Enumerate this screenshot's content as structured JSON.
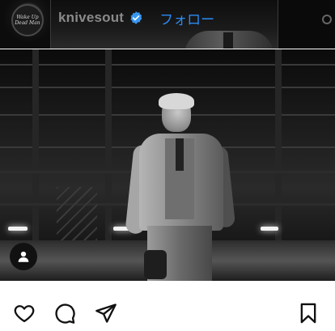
{
  "header": {
    "account": {
      "username": "knivesout",
      "verified": true,
      "follow_label": "フォロー",
      "avatar_text": "Wake Up Dead Man"
    }
  },
  "post": {
    "image_icon": "user-tag-icon"
  },
  "actions": {
    "like": "heart-icon",
    "comment": "comment-bubble-icon",
    "share": "paper-plane-icon",
    "save": "bookmark-icon"
  },
  "colors": {
    "follow": "#2a8cf5",
    "verified_badge": "#3897f0",
    "username": "#8a8a8a"
  }
}
